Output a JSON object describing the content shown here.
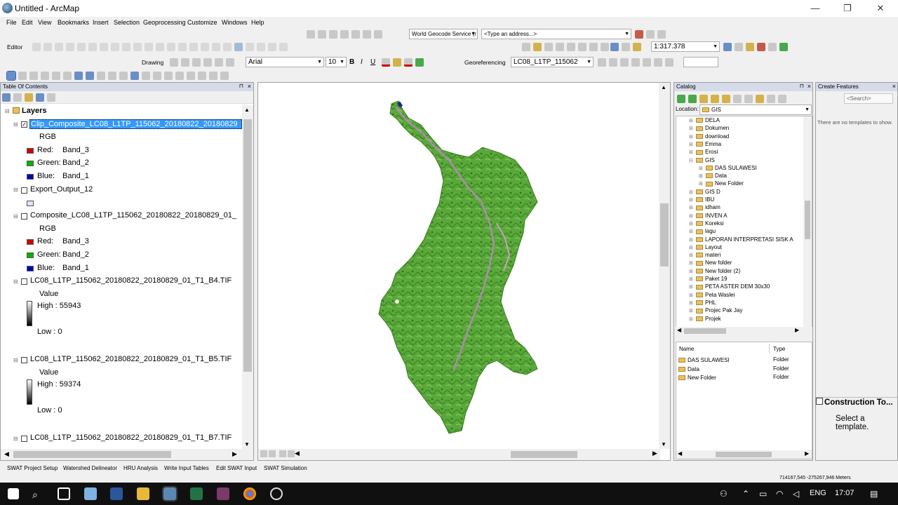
{
  "window": {
    "title": "Untitled - ArcMap",
    "minimize": "—",
    "maximize": "❐",
    "close": "✕"
  },
  "menu": [
    "File",
    "Edit",
    "View",
    "Bookmarks",
    "Insert",
    "Selection",
    "Geoprocessing",
    "Customize",
    "Windows",
    "Help"
  ],
  "toolbar": {
    "geocode_service": "World Geocode Service (r",
    "address_placeholder": "<Type an address...>",
    "editor_label": "Editor",
    "scale": "1:317.378",
    "drawing_label": "Drawing",
    "font_name": "Arial",
    "font_size": "10",
    "bold": "B",
    "italic": "I",
    "underline": "U",
    "georef_label": "Georeferencing",
    "georef_layer": "LC08_L1TP_115062"
  },
  "toc": {
    "title": "Table Of Contents",
    "root": "Layers",
    "layers": [
      {
        "name": "Clip_Composite_LC08_L1TP_115062_20180822_20180829",
        "checked": true,
        "renderer": "RGB",
        "bands": [
          {
            "label": "Red:",
            "band": "Band_3",
            "color": "#d40000"
          },
          {
            "label": "Green:",
            "band": "Band_2",
            "color": "#00b400"
          },
          {
            "label": "Blue:",
            "band": "Band_1",
            "color": "#0000c0"
          }
        ]
      },
      {
        "name": "Export_Output_12",
        "checked": false
      },
      {
        "name": "Composite_LC08_L1TP_115062_20180822_20180829_01_",
        "checked": false,
        "renderer": "RGB",
        "bands": [
          {
            "label": "Red:",
            "band": "Band_3",
            "color": "#d40000"
          },
          {
            "label": "Green:",
            "band": "Band_2",
            "color": "#00b400"
          },
          {
            "label": "Blue:",
            "band": "Band_1",
            "color": "#0000c0"
          }
        ]
      },
      {
        "name": "LC08_L1TP_115062_20180822_20180829_01_T1_B4.TIF",
        "checked": false,
        "value_label": "Value",
        "high": "High : 55943",
        "low": "Low : 0"
      },
      {
        "name": "LC08_L1TP_115062_20180822_20180829_01_T1_B5.TIF",
        "checked": false,
        "value_label": "Value",
        "high": "High : 59374",
        "low": "Low : 0"
      },
      {
        "name": "LC08_L1TP_115062_20180822_20180829_01_T1_B7.TIF",
        "checked": false
      }
    ]
  },
  "catalog": {
    "title": "Catalog",
    "location_label": "Location:",
    "location": "GIS",
    "tree": [
      "DELA",
      "Dokumen",
      "download",
      "Emma",
      "Erosi",
      "GIS",
      "DAS SULAWESI",
      "Data",
      "New Folder",
      "GIS D",
      "IBU",
      "idham",
      "INVEN A",
      "Koreksi",
      "lagu",
      "LAPORAN INTERPRETASI SISK A",
      "Layout",
      "materi",
      "New folder",
      "New folder (2)",
      "Paket 19",
      "PETA ASTER DEM 30x30",
      "Peta Waslei",
      "PHL",
      "Projec Pak Jay",
      "Projek"
    ],
    "list_headers": [
      "Name",
      "Type"
    ],
    "list": [
      {
        "name": "DAS SULAWESI",
        "type": "Folder"
      },
      {
        "name": "Data",
        "type": "Folder"
      },
      {
        "name": "New Folder",
        "type": "Folder"
      }
    ]
  },
  "create_features": {
    "title": "Create Features",
    "search_placeholder": "<Search>",
    "empty_msg": "There are no templates to show.",
    "construction_title": "Construction To...",
    "construction_msg": "Select a template."
  },
  "swat": [
    "SWAT Project Setup",
    "Watershed Delineator",
    "HRU Analysis",
    "Write Input Tables",
    "Edit SWAT Input",
    "SWAT Simulation"
  ],
  "status": {
    "coords": "714167,545  -275267,946 Meters"
  },
  "tray": {
    "lang": "ENG",
    "time": "17:07"
  }
}
